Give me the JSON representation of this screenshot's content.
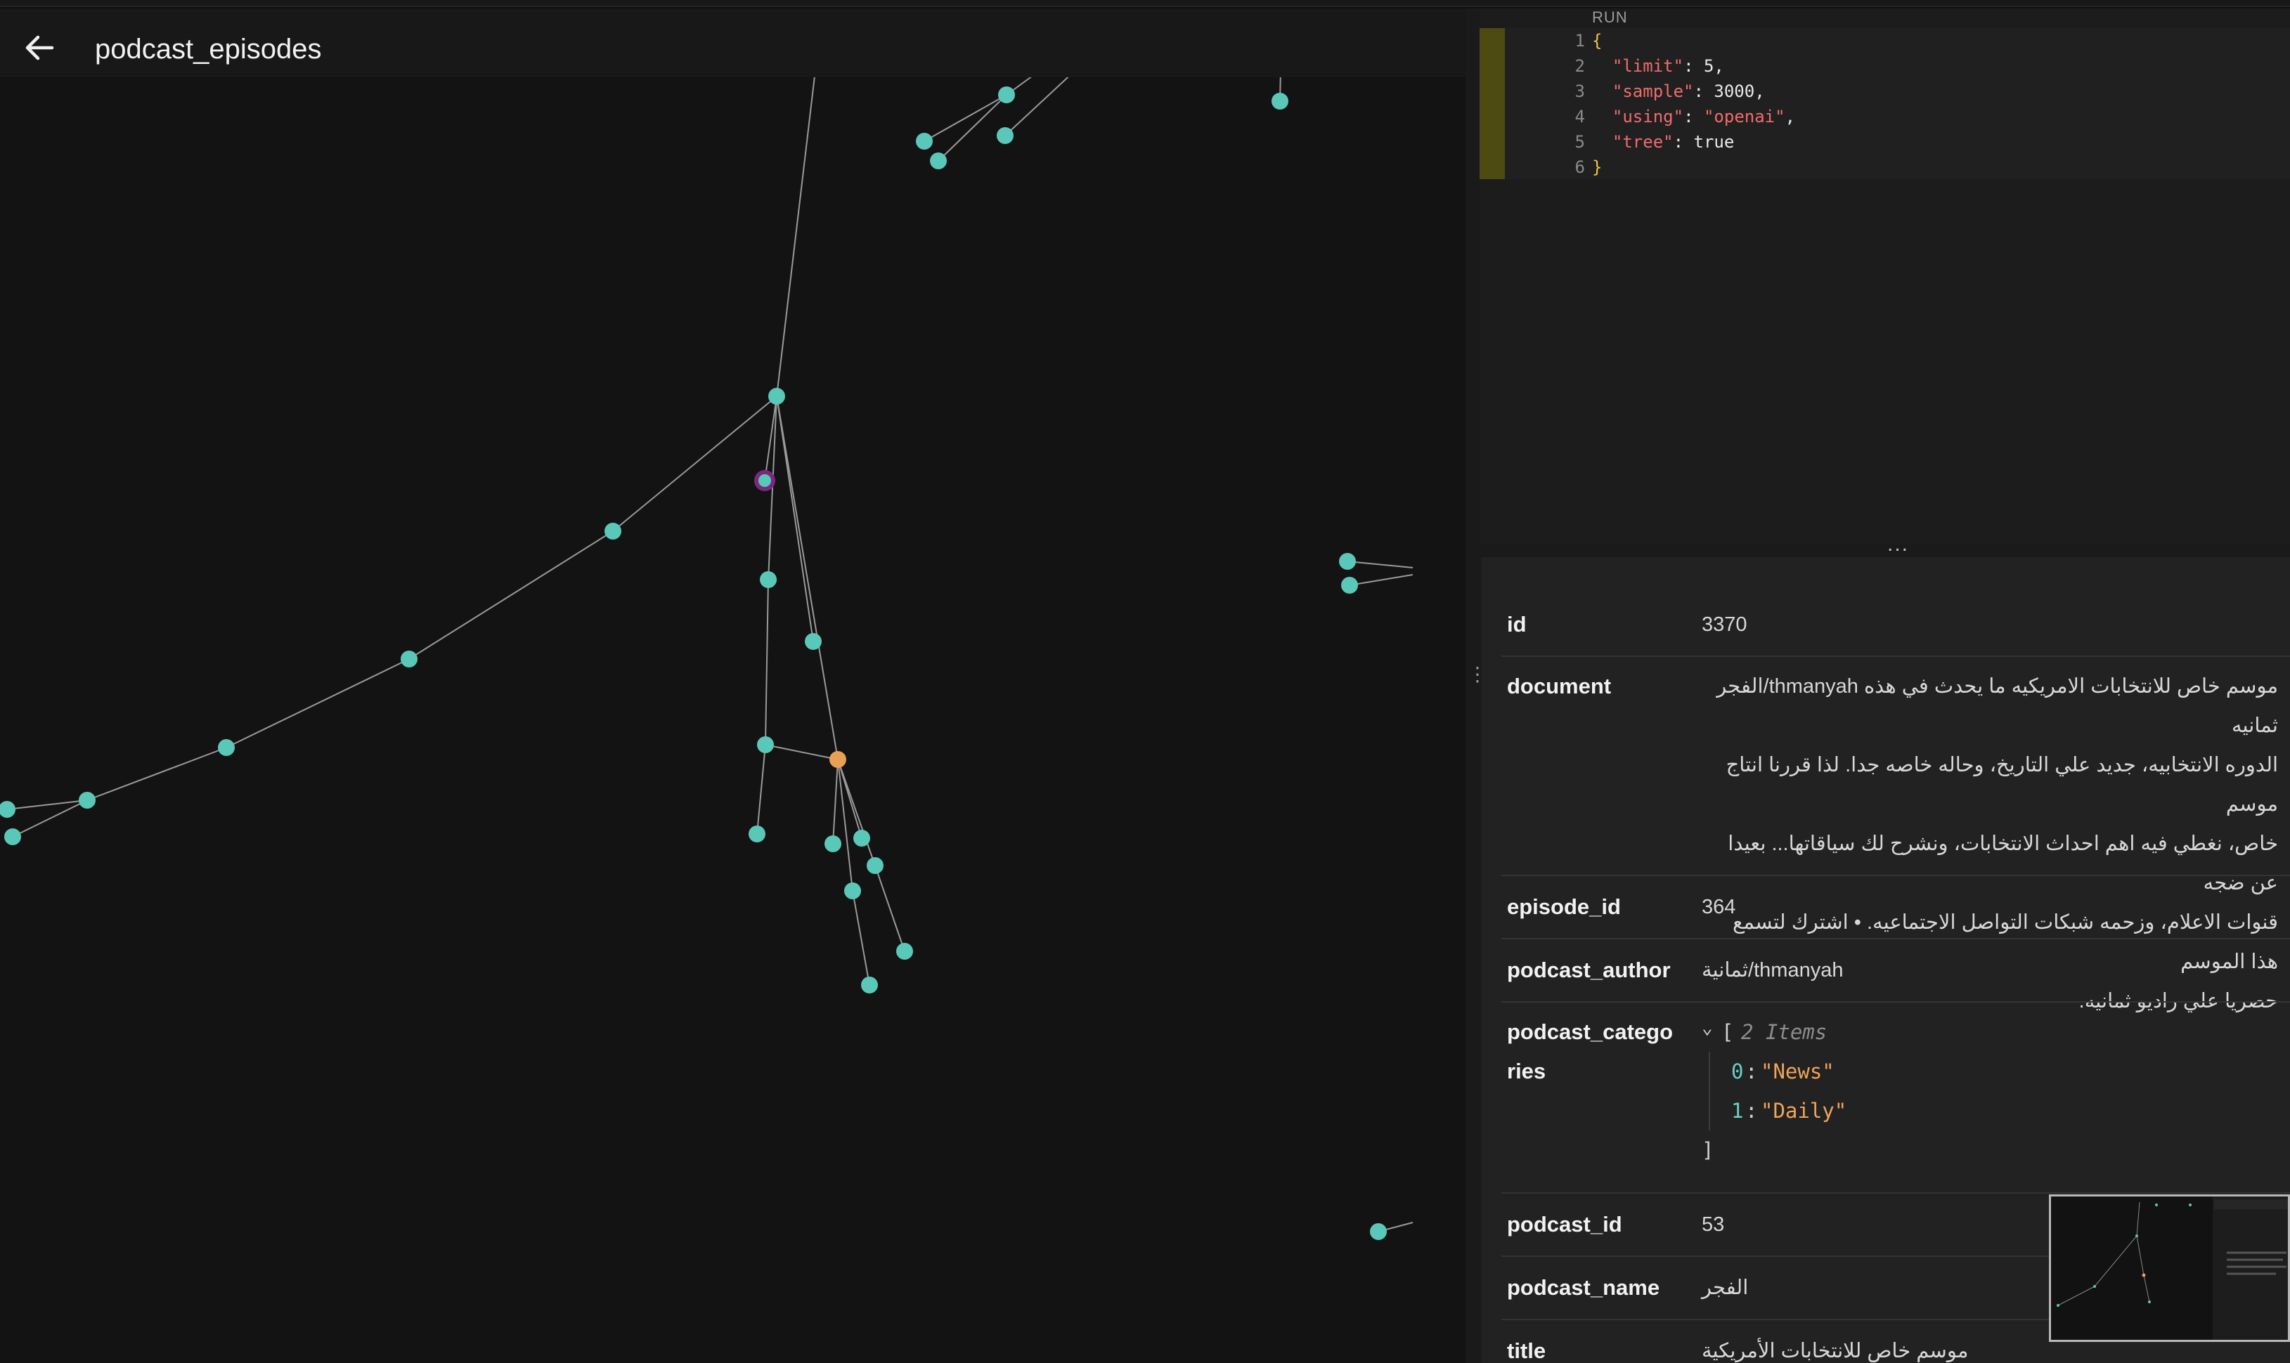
{
  "header": {
    "back_icon": "arrow-left-icon",
    "title": "podcast_episodes"
  },
  "editor": {
    "run_label": "RUN",
    "lines": [
      {
        "n": "1",
        "parts": [
          {
            "t": "{",
            "c": "brace"
          }
        ]
      },
      {
        "n": "2",
        "parts": [
          {
            "t": "  ",
            "c": "punct"
          },
          {
            "t": "\"limit\"",
            "c": "key"
          },
          {
            "t": ": ",
            "c": "punct"
          },
          {
            "t": "5",
            "c": "num"
          },
          {
            "t": ",",
            "c": "punct"
          }
        ]
      },
      {
        "n": "3",
        "parts": [
          {
            "t": "  ",
            "c": "punct"
          },
          {
            "t": "\"sample\"",
            "c": "key"
          },
          {
            "t": ": ",
            "c": "punct"
          },
          {
            "t": "3000",
            "c": "num"
          },
          {
            "t": ",",
            "c": "punct"
          }
        ]
      },
      {
        "n": "4",
        "parts": [
          {
            "t": "  ",
            "c": "punct"
          },
          {
            "t": "\"using\"",
            "c": "key"
          },
          {
            "t": ": ",
            "c": "punct"
          },
          {
            "t": "\"openai\"",
            "c": "str"
          },
          {
            "t": ",",
            "c": "punct"
          }
        ]
      },
      {
        "n": "5",
        "parts": [
          {
            "t": "  ",
            "c": "punct"
          },
          {
            "t": "\"tree\"",
            "c": "key"
          },
          {
            "t": ": ",
            "c": "punct"
          },
          {
            "t": "true",
            "c": "bool"
          }
        ]
      },
      {
        "n": "6",
        "parts": [
          {
            "t": "}",
            "c": "brace"
          }
        ]
      }
    ]
  },
  "splitters": {
    "vertical": "⋮",
    "horizontal": "..."
  },
  "details": {
    "id": {
      "key": "id",
      "value": "3370"
    },
    "document": {
      "key": "document",
      "lines": [
        "موسم خاص للانتخابات الامريكيه ما يحدث في هذه thmanyah/الفجر ثمانيه",
        "الدوره الانتخابيه، جديد علي التاريخ، وحاله خاصه جدا. لذا قررنا انتاج موسم",
        "خاص، نغطي فيه اهم احداث الانتخابات، ونشرح لك سياقاتها... بعيدا عن ضجه",
        "قنوات الاعلام، وزحمه شبكات التواصل الاجتماعيه. • اشترك لتسمع هذا الموسم",
        "حصريا علي راديو ثمانيه."
      ]
    },
    "episode_id": {
      "key": "episode_id",
      "value": "364"
    },
    "podcast_author": {
      "key": "podcast_author",
      "value": "ثمانية/thmanyah"
    },
    "podcast_categories": {
      "key_line1": "podcast_catego",
      "key_line2": "ries",
      "toggle": "⌄",
      "open_bracket": "[",
      "count_label": "2 Items",
      "items": [
        {
          "index": "0",
          "value": "\"News\""
        },
        {
          "index": "1",
          "value": "\"Daily\""
        }
      ],
      "close_bracket": "]"
    },
    "podcast_id": {
      "key": "podcast_id",
      "value": "53"
    },
    "podcast_name": {
      "key": "podcast_name",
      "value": "الفجر"
    },
    "title": {
      "key": "title",
      "value": "موسم خاص للانتخابات الأمريكية"
    }
  },
  "colors": {
    "node": "#5ac8b8",
    "selected_node_fill": "#5ac8b8",
    "selected_node_ring": "#7a2a7e",
    "highlight_node": "#e8a055",
    "edge": "#9a9a9a"
  }
}
